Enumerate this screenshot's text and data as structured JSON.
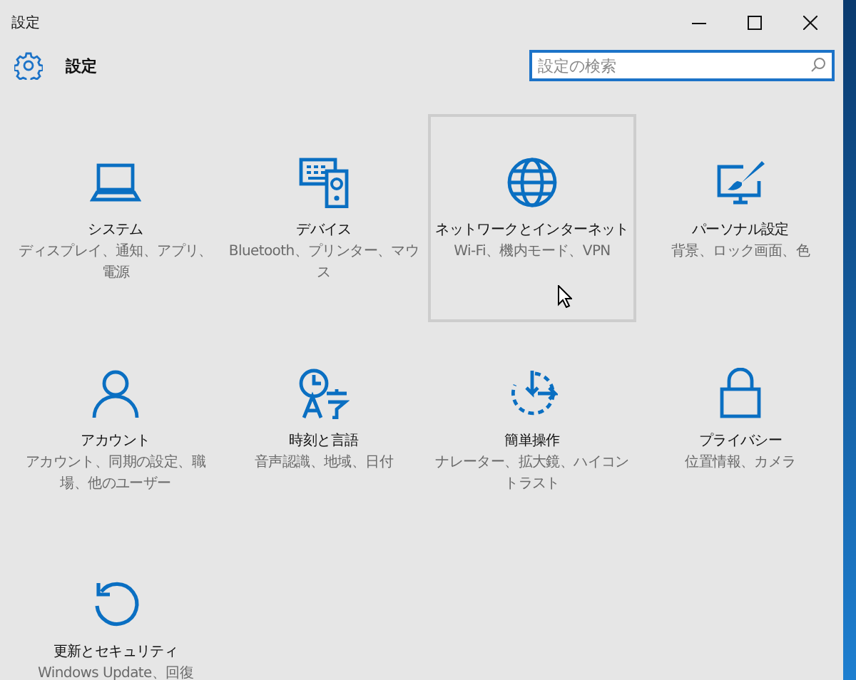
{
  "window": {
    "title": "設定"
  },
  "header": {
    "title": "設定",
    "search": {
      "placeholder": "設定の検索"
    }
  },
  "tiles": [
    {
      "title": "システム",
      "subtitle": "ディスプレイ、通知、アプリ、電源",
      "selected": false
    },
    {
      "title": "デバイス",
      "subtitle": "Bluetooth、プリンター、マウス",
      "selected": false
    },
    {
      "title": "ネットワークとインターネット",
      "subtitle": "Wi-Fi、機内モード、VPN",
      "selected": true
    },
    {
      "title": "パーソナル設定",
      "subtitle": "背景、ロック画面、色",
      "selected": false
    },
    {
      "title": "アカウント",
      "subtitle": "アカウント、同期の設定、職場、他のユーザー",
      "selected": false
    },
    {
      "title": "時刻と言語",
      "subtitle": "音声認識、地域、日付",
      "selected": false
    },
    {
      "title": "簡単操作",
      "subtitle": "ナレーター、拡大鏡、ハイコントラスト",
      "selected": false
    },
    {
      "title": "プライバシー",
      "subtitle": "位置情報、カメラ",
      "selected": false
    },
    {
      "title": "更新とセキュリティ",
      "subtitle": "Windows Update、回復",
      "selected": false
    }
  ]
}
